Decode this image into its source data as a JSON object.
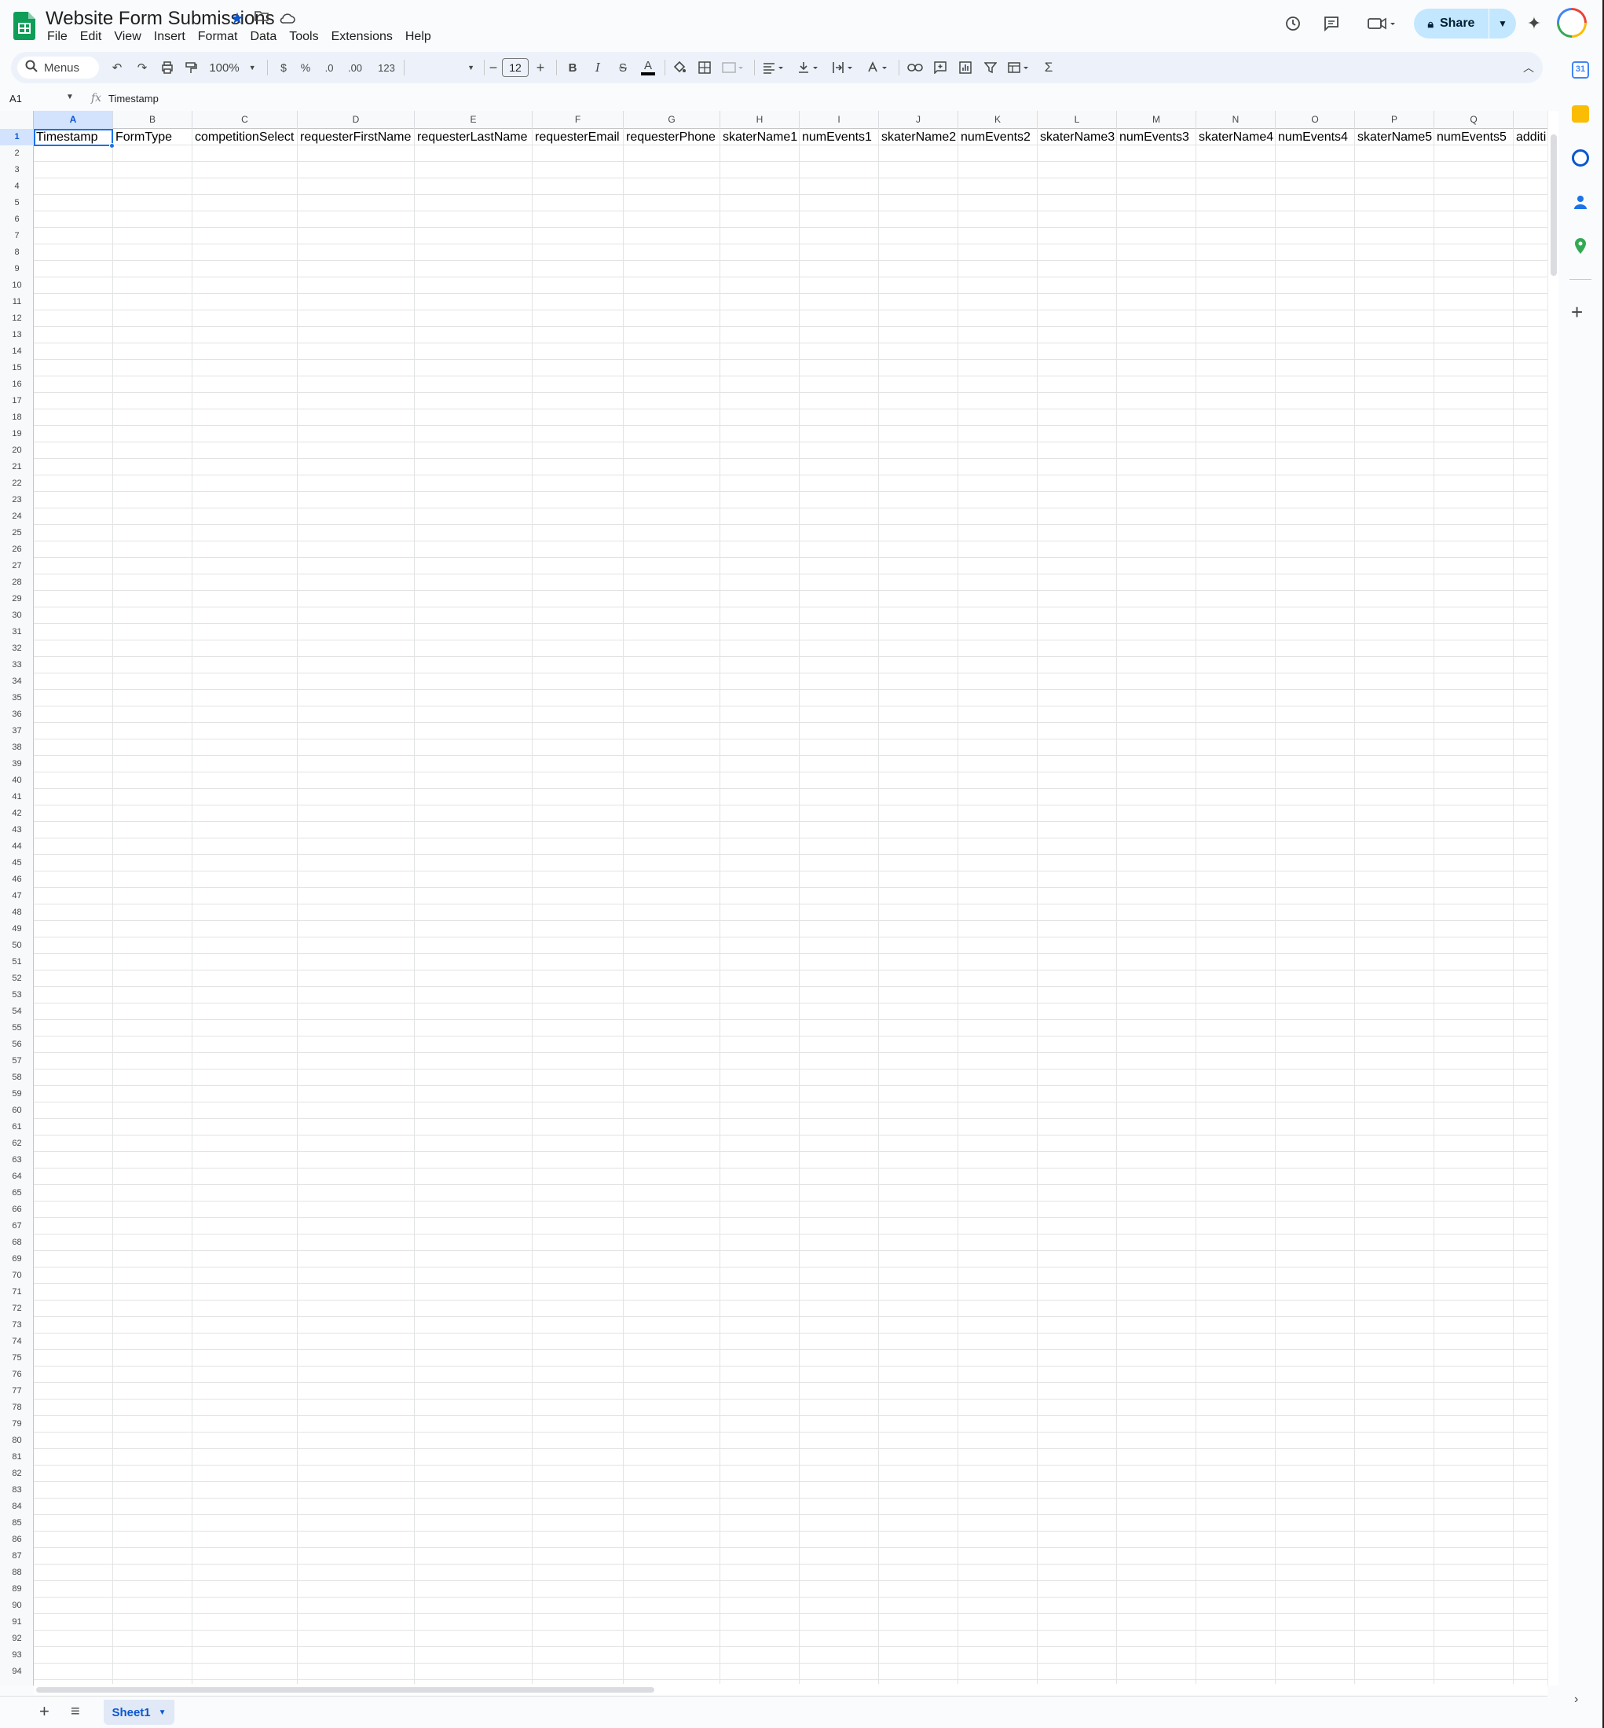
{
  "doc": {
    "title": "Website Form Submissions"
  },
  "menu": [
    "File",
    "Edit",
    "View",
    "Insert",
    "Format",
    "Data",
    "Tools",
    "Extensions",
    "Help"
  ],
  "share": {
    "label": "Share"
  },
  "toolbar": {
    "search_label": "Menus",
    "zoom": "100%",
    "currency": "$",
    "percent": "%",
    "dec_decrease": ".0",
    "dec_increase": ".00",
    "number_format": "123",
    "font_size": "12",
    "sum": "Σ"
  },
  "formula_bar": {
    "cell_ref": "A1",
    "content": "Timestamp"
  },
  "columns": [
    "A",
    "B",
    "C",
    "D",
    "E",
    "F",
    "G",
    "H",
    "I",
    "J",
    "K",
    "L",
    "M",
    "N",
    "O",
    "P",
    "Q"
  ],
  "header_row": [
    "Timestamp",
    "FormType",
    "competitionSelect",
    "requesterFirstName",
    "requesterLastName",
    "requesterEmail",
    "requesterPhone",
    "skaterName1",
    "numEvents1",
    "skaterName2",
    "numEvents2",
    "skaterName3",
    "numEvents3",
    "skaterName4",
    "numEvents4",
    "skaterName5",
    "numEvents5",
    "additi"
  ],
  "row_count": 94,
  "selected_cell": "A1",
  "sheets": [
    {
      "name": "Sheet1",
      "active": true
    }
  ],
  "colors": {
    "accent": "#1a73e8",
    "share_bg": "#c2e7ff",
    "toolbar_bg": "#edf2fa",
    "sheets_green": "#0f9d58"
  }
}
